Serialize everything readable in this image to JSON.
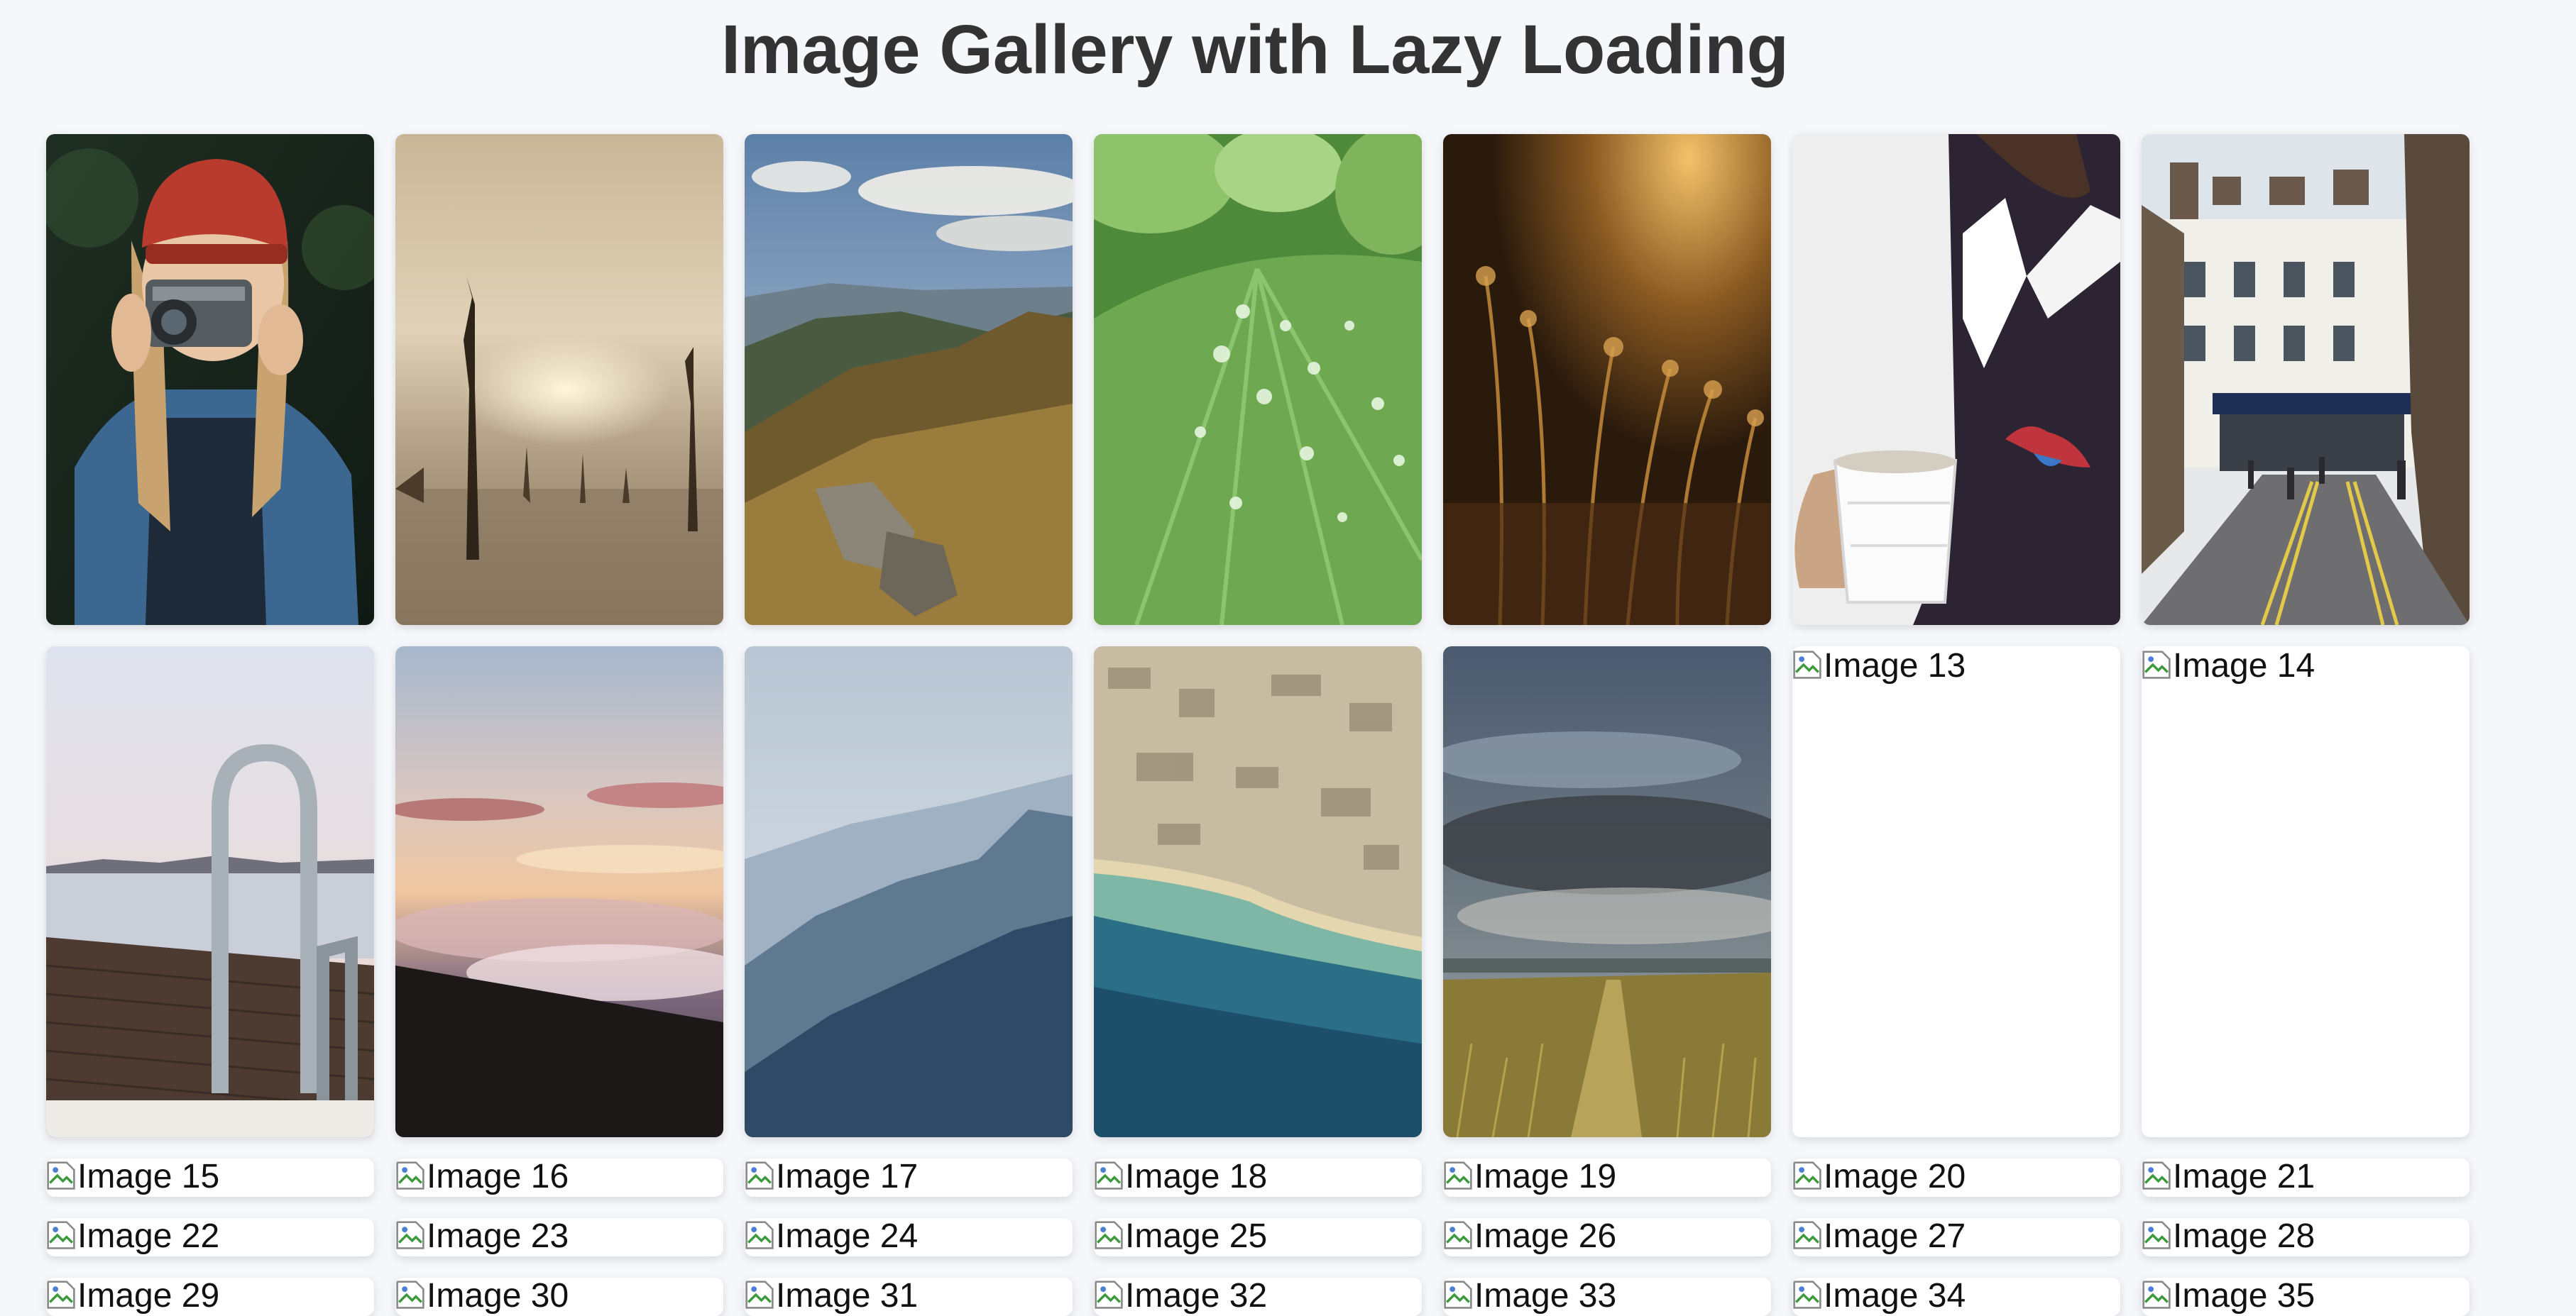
{
  "page": {
    "title": "Image Gallery with Lazy Loading"
  },
  "gallery": {
    "loaded_images": [
      {
        "subject": "woman-with-camera-photo"
      },
      {
        "subject": "foggy-dead-trees-photo"
      },
      {
        "subject": "mountain-ridge-photo"
      },
      {
        "subject": "leaf-water-drops-photo"
      },
      {
        "subject": "golden-grass-sunset-photo"
      },
      {
        "subject": "man-with-coffee-cup-photo"
      },
      {
        "subject": "london-street-photo"
      },
      {
        "subject": "pier-ladder-lake-photo"
      },
      {
        "subject": "sunset-above-clouds-photo"
      },
      {
        "subject": "misty-mountains-photo"
      },
      {
        "subject": "aerial-coastline-photo"
      },
      {
        "subject": "grass-path-cloudy-sky-photo"
      }
    ],
    "pending_images": [
      {
        "alt": "Image 13"
      },
      {
        "alt": "Image 14"
      },
      {
        "alt": "Image 15"
      },
      {
        "alt": "Image 16"
      },
      {
        "alt": "Image 17"
      },
      {
        "alt": "Image 18"
      },
      {
        "alt": "Image 19"
      },
      {
        "alt": "Image 20"
      },
      {
        "alt": "Image 21"
      },
      {
        "alt": "Image 22"
      },
      {
        "alt": "Image 23"
      },
      {
        "alt": "Image 24"
      },
      {
        "alt": "Image 25"
      },
      {
        "alt": "Image 26"
      },
      {
        "alt": "Image 27"
      },
      {
        "alt": "Image 28"
      },
      {
        "alt": "Image 29"
      },
      {
        "alt": "Image 30"
      },
      {
        "alt": "Image 31"
      },
      {
        "alt": "Image 32"
      },
      {
        "alt": "Image 33"
      },
      {
        "alt": "Image 34"
      },
      {
        "alt": "Image 35"
      }
    ]
  },
  "colors": {
    "background": "#f5f7fa",
    "title": "#333333",
    "card": "#ffffff"
  }
}
